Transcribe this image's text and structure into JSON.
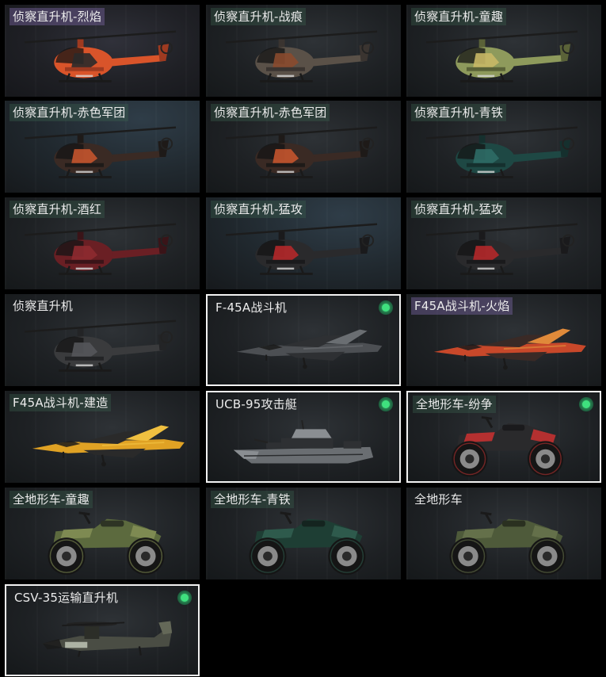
{
  "cards": [
    {
      "label": "侦察直升机-烈焰",
      "kind": "heli",
      "label_style": "purple",
      "rarity": "purple",
      "selected": false,
      "badge": false,
      "colors": {
        "body": "#d9542a",
        "accent": "#2a2a2a",
        "trim": "#9e3a20"
      }
    },
    {
      "label": "侦察直升机-战痕",
      "kind": "heli",
      "label_style": "green",
      "rarity": "normal",
      "selected": false,
      "badge": false,
      "colors": {
        "body": "#5a5148",
        "accent": "#8a4a2e",
        "trim": "#3a3430"
      }
    },
    {
      "label": "侦察直升机-童趣",
      "kind": "heli",
      "label_style": "green",
      "rarity": "normal",
      "selected": false,
      "badge": false,
      "colors": {
        "body": "#8e9a5c",
        "accent": "#c8b866",
        "trim": "#5a6238"
      }
    },
    {
      "label": "侦察直升机-赤色军团",
      "kind": "heli",
      "label_style": "green",
      "rarity": "blue",
      "selected": false,
      "badge": false,
      "colors": {
        "body": "#3a2a24",
        "accent": "#c4542e",
        "trim": "#1e1a18"
      }
    },
    {
      "label": "侦察直升机-赤色军团",
      "kind": "heli",
      "label_style": "green",
      "rarity": "normal",
      "selected": false,
      "badge": false,
      "colors": {
        "body": "#3a2a24",
        "accent": "#c4542e",
        "trim": "#1e1a18"
      }
    },
    {
      "label": "侦察直升机-青铁",
      "kind": "heli",
      "label_style": "green",
      "rarity": "normal",
      "selected": false,
      "badge": false,
      "colors": {
        "body": "#1e4844",
        "accent": "#2e6c66",
        "trim": "#15302e"
      }
    },
    {
      "label": "侦察直升机-酒红",
      "kind": "heli",
      "label_style": "green",
      "rarity": "normal",
      "selected": false,
      "badge": false,
      "colors": {
        "body": "#6a1f24",
        "accent": "#8e2a30",
        "trim": "#3a1418"
      }
    },
    {
      "label": "侦察直升机-猛攻",
      "kind": "heli",
      "label_style": "green",
      "rarity": "blue",
      "selected": false,
      "badge": false,
      "colors": {
        "body": "#2a2a2c",
        "accent": "#b4282a",
        "trim": "#1a1a1c"
      }
    },
    {
      "label": "侦察直升机-猛攻",
      "kind": "heli",
      "label_style": "green",
      "rarity": "normal",
      "selected": false,
      "badge": false,
      "colors": {
        "body": "#2a2a2c",
        "accent": "#b4282a",
        "trim": "#1a1a1c"
      }
    },
    {
      "label": "侦察直升机",
      "kind": "heli",
      "label_style": "plain",
      "rarity": "normal",
      "selected": false,
      "badge": false,
      "colors": {
        "body": "#3a3b3d",
        "accent": "#55575a",
        "trim": "#232426"
      }
    },
    {
      "label": "F-45A战斗机",
      "kind": "jet",
      "label_style": "plain",
      "rarity": "normal",
      "selected": true,
      "badge": true,
      "colors": {
        "body": "#4c4f53",
        "accent": "#6a6e72",
        "trim": "#2e3033"
      }
    },
    {
      "label": "F45A战斗机-火焰",
      "kind": "jet",
      "label_style": "purple",
      "rarity": "normal",
      "selected": false,
      "badge": false,
      "colors": {
        "body": "#c8482a",
        "accent": "#e08a3a",
        "trim": "#3a2a26"
      }
    },
    {
      "label": "F45A战斗机-建造",
      "kind": "jet",
      "label_style": "green",
      "rarity": "normal",
      "selected": false,
      "badge": false,
      "colors": {
        "body": "#e0a224",
        "accent": "#f0c040",
        "trim": "#2a2a2a"
      }
    },
    {
      "label": "UCB-95攻击艇",
      "kind": "boat",
      "label_style": "plain",
      "rarity": "normal",
      "selected": true,
      "badge": true,
      "colors": {
        "body": "#6a6e72",
        "accent": "#8a8e92",
        "trim": "#2e3033"
      }
    },
    {
      "label": "全地形车-纷争",
      "kind": "atv",
      "label_style": "green",
      "rarity": "normal",
      "selected": true,
      "badge": true,
      "colors": {
        "body": "#2a2a2c",
        "accent": "#b43030",
        "trim": "#1a1a1c"
      }
    },
    {
      "label": "全地形车-童趣",
      "kind": "atv",
      "label_style": "green",
      "rarity": "normal",
      "selected": false,
      "badge": false,
      "colors": {
        "body": "#5c6a3e",
        "accent": "#7e8a52",
        "trim": "#2e3424"
      }
    },
    {
      "label": "全地形车-青铁",
      "kind": "atv",
      "label_style": "green",
      "rarity": "normal",
      "selected": false,
      "badge": false,
      "colors": {
        "body": "#1e3e34",
        "accent": "#2e5a4c",
        "trim": "#14241f"
      }
    },
    {
      "label": "全地形车",
      "kind": "atv",
      "label_style": "plain",
      "rarity": "normal",
      "selected": false,
      "badge": false,
      "colors": {
        "body": "#4e5a3a",
        "accent": "#64704a",
        "trim": "#2a3020"
      }
    },
    {
      "label": "CSV-35运输直升机",
      "kind": "tilt",
      "label_style": "plain",
      "rarity": "normal",
      "selected": true,
      "badge": true,
      "colors": {
        "body": "#4a4d44",
        "accent": "#646858",
        "trim": "#2c2e28"
      }
    }
  ]
}
